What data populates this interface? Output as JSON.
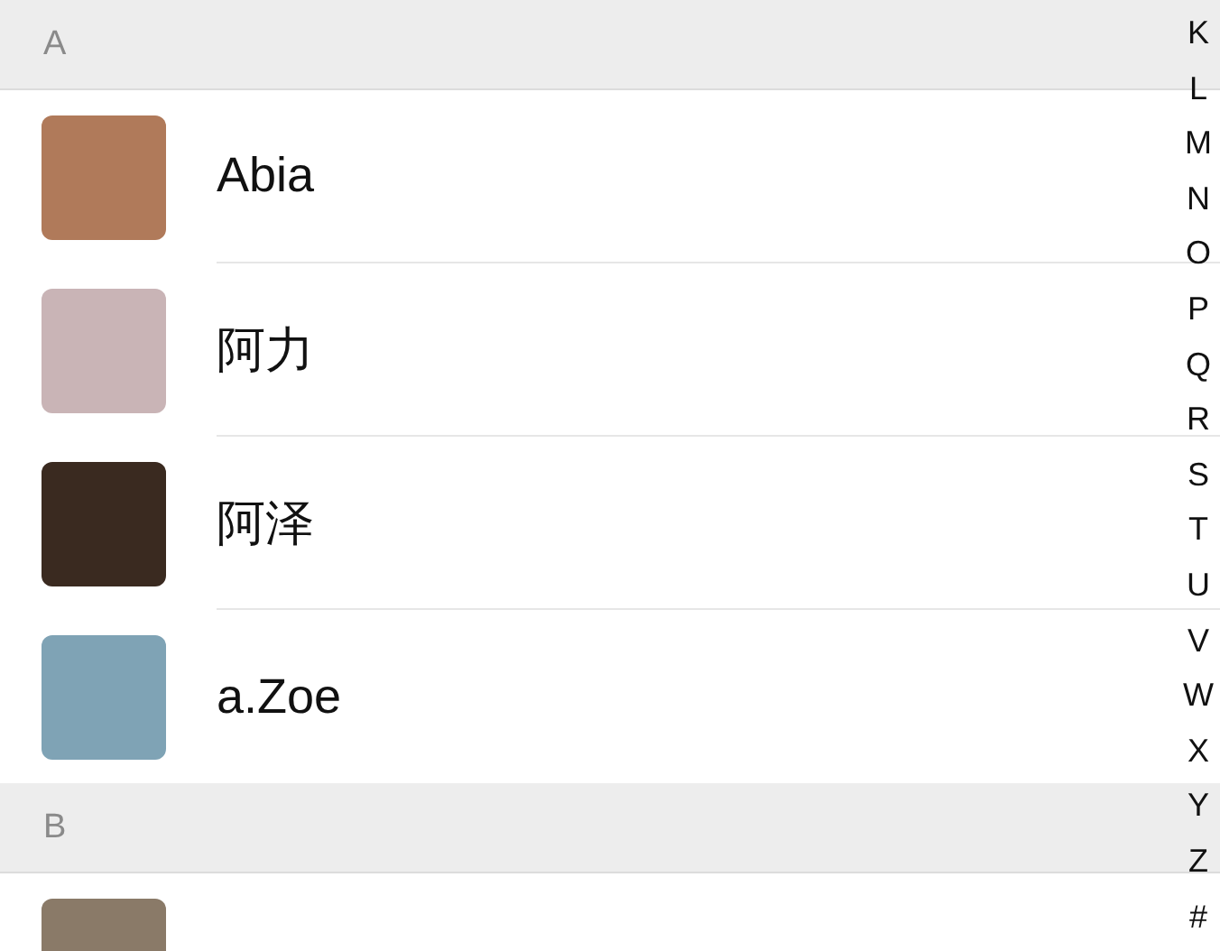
{
  "sections": [
    {
      "letter": "A",
      "contacts": [
        {
          "name": "Abia"
        },
        {
          "name": "阿力"
        },
        {
          "name": "阿泽"
        },
        {
          "name": "a.Zoe"
        }
      ]
    },
    {
      "letter": "B"
    }
  ],
  "index": [
    "K",
    "L",
    "M",
    "N",
    "O",
    "P",
    "Q",
    "R",
    "S",
    "T",
    "U",
    "V",
    "W",
    "X",
    "Y",
    "Z",
    "#"
  ]
}
